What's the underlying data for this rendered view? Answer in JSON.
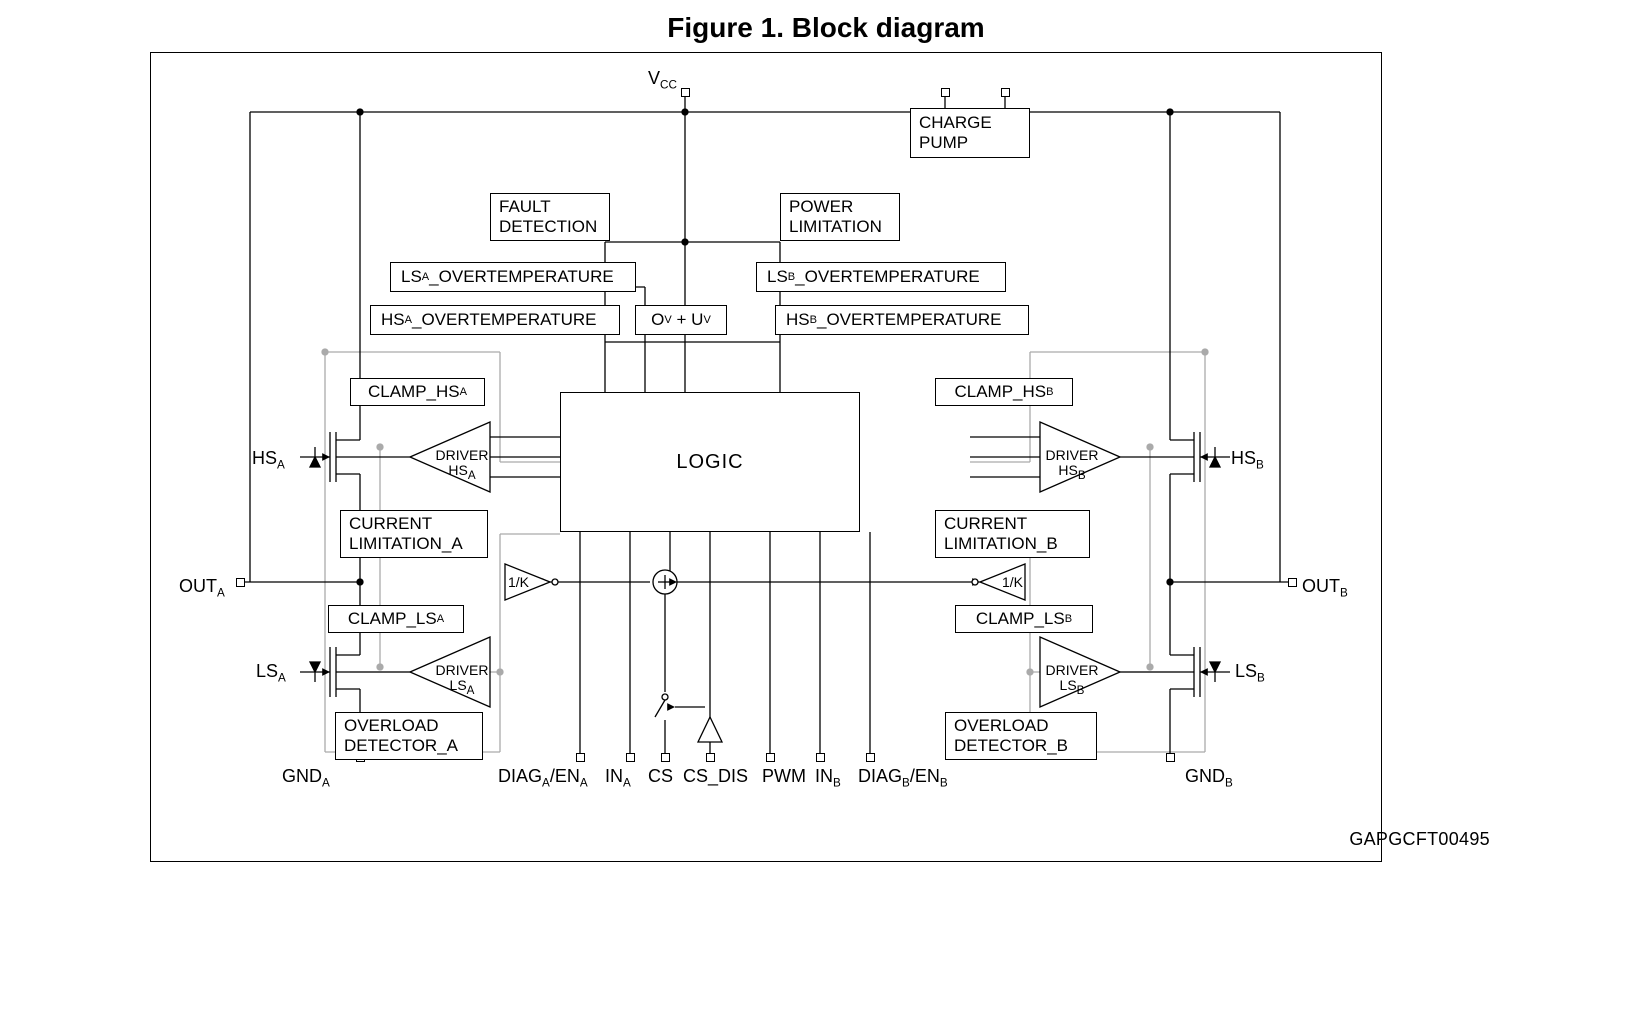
{
  "figure_title": "Figure 1. Block diagram",
  "footer_code": "GAPGCFT00495",
  "blocks": {
    "charge_pump": "CHARGE\nPUMP",
    "fault": "FAULT\nDETECTION",
    "power_lim": "POWER\nLIMITATION",
    "lsa_ot": "LS<sub>A</sub>_OVERTEMPERATURE",
    "lsb_ot": "LS<sub>B</sub>_OVERTEMPERATURE",
    "hsa_ot": "HS<sub>A</sub>_OVERTEMPERATURE",
    "hsb_ot": "HS<sub>B</sub>_OVERTEMPERATURE",
    "ov_uv": "O<sub>V</sub> + U<sub>V</sub>",
    "clamp_hsa": "CLAMP_HS<sub>A</sub>",
    "clamp_hsb": "CLAMP_HS<sub>B</sub>",
    "cur_lim_a": "CURRENT\nLIMITATION_A",
    "cur_lim_b": "CURRENT\nLIMITATION_B",
    "clamp_lsa": "CLAMP_LS<sub>A</sub>",
    "clamp_lsb": "CLAMP_LS<sub>B</sub>",
    "overload_a": "OVERLOAD\nDETECTOR_A",
    "overload_b": "OVERLOAD\nDETECTOR_B",
    "logic": "LOGIC",
    "drv_hsa": "DRIVER\nHS<sub>A</sub>",
    "drv_hsb": "DRIVER\nHS<sub>B</sub>",
    "drv_lsa": "DRIVER\nLS<sub>A</sub>",
    "drv_lsb": "DRIVER\nLS<sub>B</sub>",
    "gain": "1/K"
  },
  "pins": {
    "vcc": "V<sub>CC</sub>",
    "out_a": "OUT<sub>A</sub>",
    "out_b": "OUT<sub>B</sub>",
    "hs_a": "HS<sub>A</sub>",
    "hs_b": "HS<sub>B</sub>",
    "ls_a": "LS<sub>A</sub>",
    "ls_b": "LS<sub>B</sub>",
    "gnd_a": "GND<sub>A</sub>",
    "gnd_b": "GND<sub>B</sub>",
    "diag_a": "DIAG<sub>A</sub>/EN<sub>A</sub>",
    "in_a": "IN<sub>A</sub>",
    "cs": "CS",
    "cs_dis": "CS_DIS",
    "pwm": "PWM",
    "in_b": "IN<sub>B</sub>",
    "diag_b": "DIAG<sub>B</sub>/EN<sub>B</sub>"
  }
}
